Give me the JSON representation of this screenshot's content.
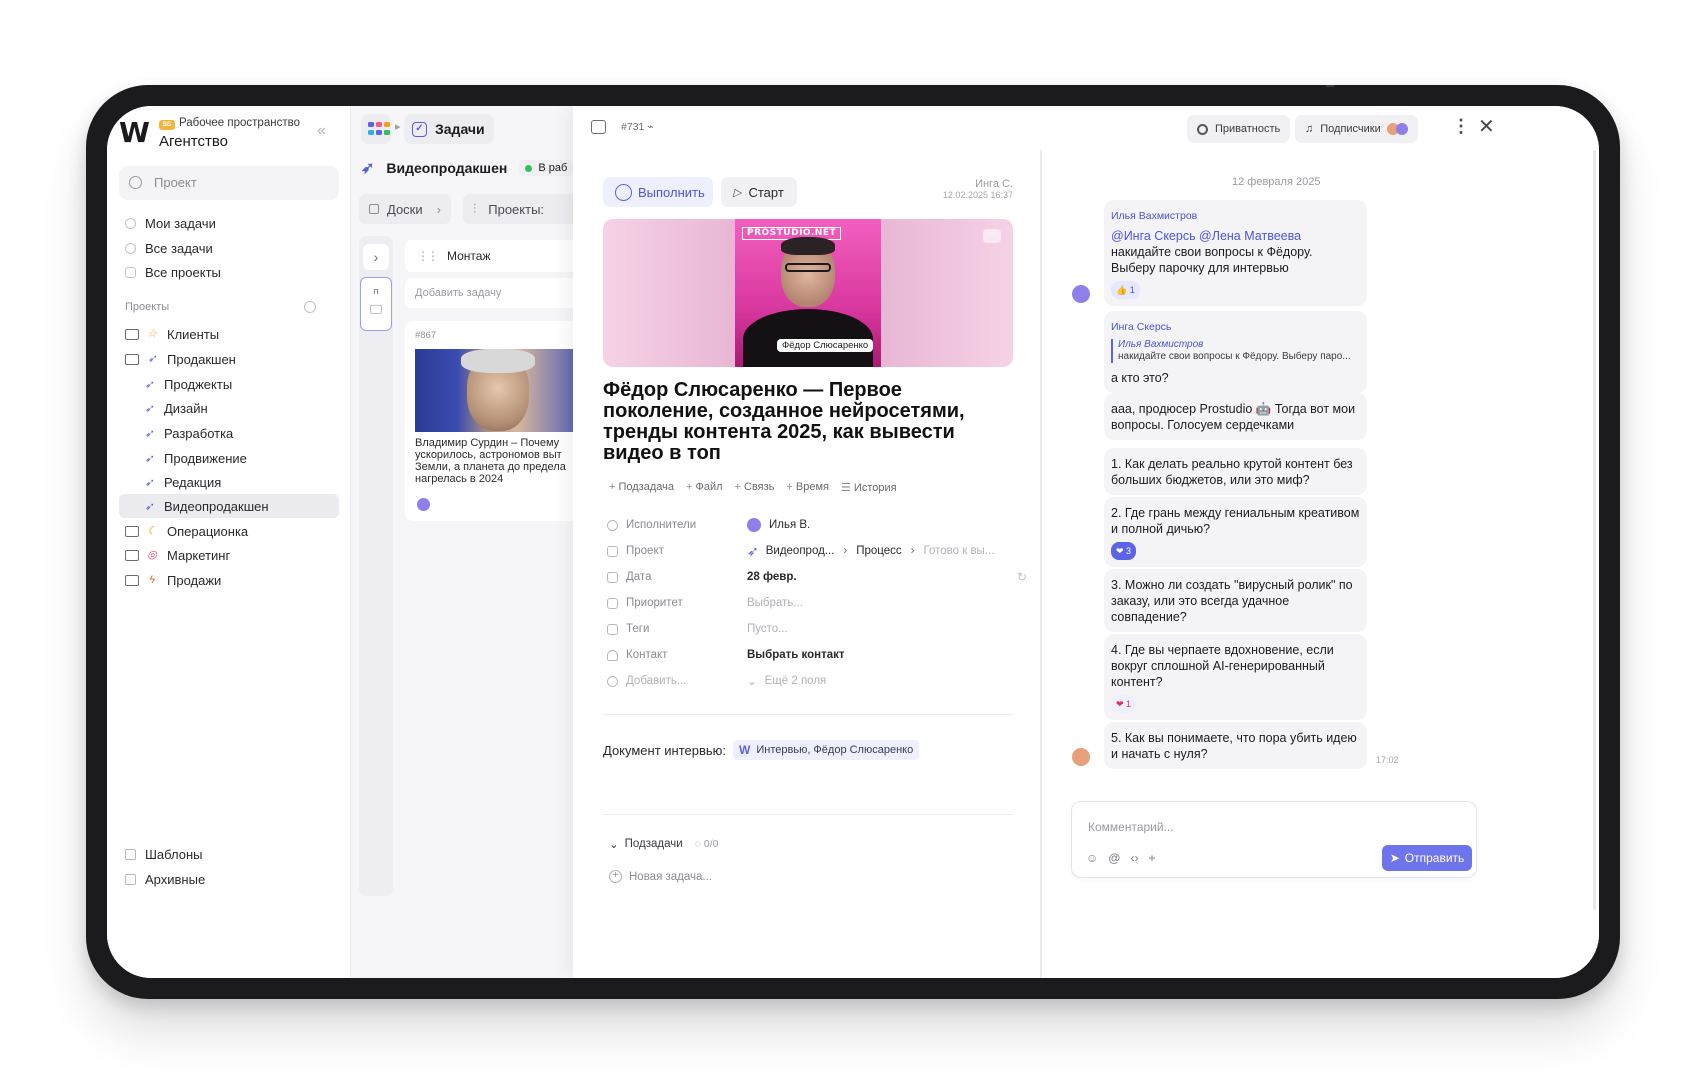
{
  "workspace": {
    "badge": "ВБ",
    "subtitle": "Рабочее пространство",
    "name": "Агентство"
  },
  "sidebar": {
    "search_placeholder": "Проект",
    "nav": [
      "Мои задачи",
      "Все задачи",
      "Все проекты"
    ],
    "projects_heading": "Проекты",
    "projects": [
      {
        "label": "Клиенты",
        "icon": "star-icon",
        "kind": "folder"
      },
      {
        "label": "Продакшен",
        "icon": "rocket-icon",
        "kind": "folder"
      },
      {
        "label": "Проджекты",
        "icon": "rocket-icon",
        "kind": "child"
      },
      {
        "label": "Дизайн",
        "icon": "rocket-icon",
        "kind": "child"
      },
      {
        "label": "Разработка",
        "icon": "rocket-icon",
        "kind": "child"
      },
      {
        "label": "Продвижение",
        "icon": "rocket-icon",
        "kind": "child"
      },
      {
        "label": "Редакция",
        "icon": "rocket-icon",
        "kind": "child"
      },
      {
        "label": "Видеопродакшен",
        "icon": "rocket-icon",
        "kind": "child",
        "active": true
      },
      {
        "label": "Операционка",
        "icon": "moon-icon",
        "kind": "folder"
      },
      {
        "label": "Маркетинг",
        "icon": "target-icon",
        "kind": "folder"
      },
      {
        "label": "Продажи",
        "icon": "lightning-icon",
        "kind": "folder"
      }
    ],
    "bottom": [
      "Шаблоны",
      "Архивные"
    ]
  },
  "board": {
    "crumb_tasks": "Задачи",
    "project_title": "Видеопродакшен",
    "status": "В раб",
    "filter_boards": "Доски",
    "filter_projects": "Проекты:",
    "mini_label": "п",
    "column_title": "Монтаж",
    "add_task": "Добавить задачу",
    "card": {
      "number": "#867",
      "text": "Владимир Сурдин – Почему ускорилось, астрономов выт Земли, а планета до предела нагрелась в 2024"
    }
  },
  "task": {
    "id": "#731",
    "privacy": "Приватность",
    "subscribers": "Подписчики",
    "do_button": "Выполнить",
    "start_button": "Старт",
    "author": "Инга С.",
    "created": "12.02.2025 16:37",
    "cover_logo": "PROSTUDIO.NET",
    "cover_name": "Фёдор Слюсаренко",
    "title": "Фёдор Слюсаренко — Первое поколение, созданное нейросетями, тренды контента 2025, как вывести видео в топ",
    "actions": [
      "Подзадача",
      "Файл",
      "Связь",
      "Время",
      "История"
    ],
    "fields": {
      "assignees_label": "Исполнители",
      "assignees_value": "Илья В.",
      "project_label": "Проект",
      "project_value": "Видеопрод...",
      "project_stage": "Процесс",
      "project_next": "Готово к вы...",
      "date_label": "Дата",
      "date_value": "28 февр.",
      "priority_label": "Приоритет",
      "priority_value": "Выбрать...",
      "tags_label": "Теги",
      "tags_value": "Пусто...",
      "contact_label": "Контакт",
      "contact_value": "Выбрать контакт",
      "add_label": "Добавить...",
      "more_fields": "Ещё 2 поля"
    },
    "document_label": "Документ интервью:",
    "document_chip": "Интервью, Фёдор Слюсаренко",
    "subtasks_label": "Подзадачи",
    "subtasks_count": "0/0",
    "new_task": "Новая задача..."
  },
  "chat": {
    "date": "12 февраля 2025",
    "m1": {
      "author": "Илья Вахмистров",
      "mentions": "@Инга Скерсь @Лена Матвеева",
      "text": " накидайте свои вопросы к Фёдору. Выберу парочку для интервью",
      "reaction": "👍 1"
    },
    "m2": {
      "author": "Инга Скерсь",
      "quote_author": "Илья Вахмистров",
      "quote_text": "накидайте свои вопросы к Фёдору. Выберу паро...",
      "text": "а кто это?"
    },
    "m3": {
      "text_a": "ааа, продюсер Prostudio",
      "text_b": " Тогда вот мои вопросы. Голосуем сердечками"
    },
    "m4": "1. Как делать реально крутой контент без больших бюджетов, или это миф?",
    "m5": {
      "text": "2. Где грань между гениальным креативом и полной дичью?",
      "reaction": "❤ 3"
    },
    "m6": "3. Можно ли создать \"вирусный ролик\" по заказу, или это всегда удачное совпадение?",
    "m7": {
      "text": "4. Где вы черпаете вдохновение, если вокруг сплошной AI-генерированный контент?",
      "reaction": "❤ 1"
    },
    "m8": "5. Как вы понимаете, что пора убить идею и начать с нуля?",
    "time": "17:02",
    "composer_placeholder": "Комментарий...",
    "send": "Отправить"
  },
  "colors": {
    "accent": "#5b63e6",
    "status_green": "#30c060",
    "cover_pink": "#e59ccb"
  }
}
